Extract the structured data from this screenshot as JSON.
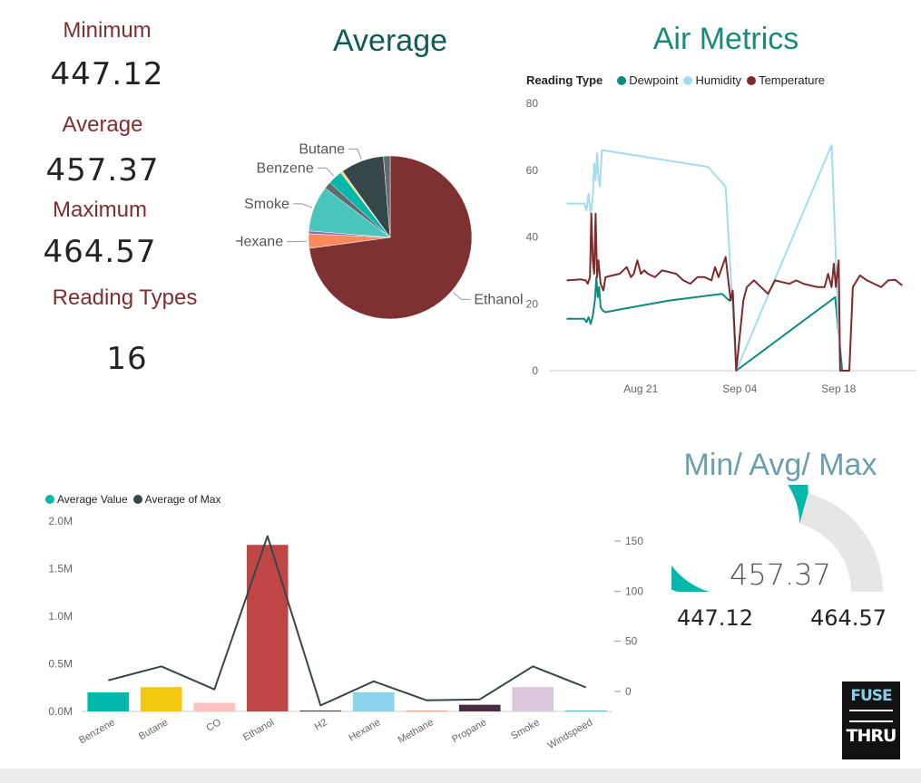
{
  "kpis": {
    "minimum_label": "Minimum",
    "minimum_value": "447.12",
    "average_label": "Average",
    "average_value": "457.37",
    "maximum_label": "Maximum",
    "maximum_value": "464.57",
    "reading_types_label": "Reading Types",
    "reading_types_value": "16"
  },
  "colors": {
    "kpi_label": "#7f2f2f",
    "title_teal": "#1a8a7a",
    "title_dark_teal": "#0e5c55",
    "gauge_fill": "#01b8aa",
    "gauge_track": "#e6e6e6",
    "gauge_title": "#6c9fae"
  },
  "chart_data": [
    {
      "type": "pie",
      "title": "Average",
      "slices": [
        {
          "label": "Ethanol",
          "value": 76.5,
          "color": "#7f3030"
        },
        {
          "label": "Hexane",
          "value": 3.0,
          "color": "#fd8a5e"
        },
        {
          "label": "",
          "value": 0.6,
          "color": "#8d6fb0"
        },
        {
          "label": "Smoke",
          "value": 9.5,
          "color": "#4ac5bb"
        },
        {
          "label": "",
          "value": 1.5,
          "color": "#5f6b6d"
        },
        {
          "label": "Benzene",
          "value": 3.0,
          "color": "#01b8aa"
        },
        {
          "label": "",
          "value": 0.3,
          "color": "#f2c80f"
        },
        {
          "label": "",
          "value": 0.2,
          "color": "#ffc0c0"
        },
        {
          "label": "Butane",
          "value": 9.0,
          "color": "#374649"
        },
        {
          "label": "",
          "value": 1.4,
          "color": "#5f6b6d"
        }
      ]
    },
    {
      "type": "line",
      "title": "Air Metrics",
      "legend_title": "Reading Type",
      "y_ticks": [
        0,
        20,
        40,
        60,
        80
      ],
      "ylim": [
        0,
        80
      ],
      "x_ticks": [
        "Aug 21",
        "Sep 04",
        "Sep 18"
      ],
      "x_tick_days": [
        21,
        35,
        49
      ],
      "xlim_days": [
        8,
        60
      ],
      "series": [
        {
          "name": "Dewpoint",
          "color": "#0e8a7e",
          "points": [
            [
              10.5,
              15.5
            ],
            [
              13,
              15.5
            ],
            [
              13.3,
              14.5
            ],
            [
              13.6,
              16
            ],
            [
              13.9,
              14
            ],
            [
              14.2,
              16.5
            ],
            [
              14.5,
              21
            ],
            [
              14.7,
              28
            ],
            [
              14.9,
              22
            ],
            [
              15.1,
              25
            ],
            [
              15.3,
              19
            ],
            [
              15.6,
              18
            ],
            [
              16,
              17.5
            ],
            [
              18,
              18.3
            ],
            [
              25,
              21
            ],
            [
              32.5,
              23
            ],
            [
              33.5,
              21
            ],
            [
              34,
              23
            ],
            [
              34.5,
              0
            ],
            [
              48.5,
              22
            ],
            [
              49.5,
              0
            ]
          ]
        },
        {
          "name": "Humidity",
          "color": "#a4dcef",
          "points": [
            [
              10.5,
              50
            ],
            [
              13,
              50
            ],
            [
              13.3,
              48
            ],
            [
              13.6,
              53
            ],
            [
              13.9,
              47
            ],
            [
              14.2,
              52
            ],
            [
              14.4,
              62
            ],
            [
              14.6,
              57
            ],
            [
              14.8,
              65
            ],
            [
              15.0,
              58
            ],
            [
              15.2,
              55
            ],
            [
              15.5,
              66
            ],
            [
              30.5,
              61
            ],
            [
              33,
              55
            ],
            [
              34.5,
              0
            ],
            [
              48,
              67.5
            ],
            [
              49.2,
              0
            ]
          ]
        },
        {
          "name": "Temperature",
          "color": "#7f2a2a",
          "points": [
            [
              10.5,
              27
            ],
            [
              12.5,
              27.3
            ],
            [
              13.2,
              27
            ],
            [
              13.5,
              26
            ],
            [
              13.8,
              28
            ],
            [
              14.0,
              47
            ],
            [
              14.2,
              33
            ],
            [
              14.4,
              29
            ],
            [
              14.6,
              47
            ],
            [
              14.8,
              28
            ],
            [
              15,
              33
            ],
            [
              15.3,
              26
            ],
            [
              15.7,
              24
            ],
            [
              16,
              28
            ],
            [
              17,
              28.5
            ],
            [
              18,
              29
            ],
            [
              19,
              31
            ],
            [
              19.6,
              28
            ],
            [
              20,
              29
            ],
            [
              20.5,
              33
            ],
            [
              21,
              29
            ],
            [
              21.5,
              30
            ],
            [
              22,
              29
            ],
            [
              23,
              28
            ],
            [
              24,
              30
            ],
            [
              25,
              29.5
            ],
            [
              26,
              29
            ],
            [
              27,
              27
            ],
            [
              28,
              26
            ],
            [
              29,
              28
            ],
            [
              30,
              28
            ],
            [
              31,
              27
            ],
            [
              31.5,
              31
            ],
            [
              32,
              28
            ],
            [
              33,
              34
            ],
            [
              33.7,
              21
            ],
            [
              34.0,
              24
            ],
            [
              34.5,
              0
            ],
            [
              35.5,
              21
            ],
            [
              36,
              25
            ],
            [
              37,
              27
            ],
            [
              38,
              25
            ],
            [
              39,
              23
            ],
            [
              40,
              27
            ],
            [
              41,
              26.5
            ],
            [
              42,
              26
            ],
            [
              43,
              27
            ],
            [
              44,
              26
            ],
            [
              45,
              25.5
            ],
            [
              46,
              25
            ],
            [
              47,
              25
            ],
            [
              47.5,
              29
            ],
            [
              48,
              25
            ],
            [
              48.3,
              32
            ],
            [
              48.6,
              25
            ],
            [
              49,
              33
            ],
            [
              49.2,
              0
            ],
            [
              50.5,
              0
            ],
            [
              51,
              25
            ],
            [
              52,
              28.5
            ],
            [
              53,
              27
            ],
            [
              54,
              26
            ],
            [
              55,
              25
            ],
            [
              56,
              27
            ],
            [
              57,
              27.2
            ],
            [
              58,
              25.5
            ]
          ]
        }
      ]
    },
    {
      "type": "bar",
      "title": "",
      "legend": [
        "Average Value",
        "Average of Max"
      ],
      "categories": [
        "Benzene",
        "Butane",
        "CO",
        "Ethanol",
        "H2",
        "Hexane",
        "Methane",
        "Propane",
        "Smoke",
        "Windspeed"
      ],
      "bar_colors": [
        "#01b8aa",
        "#f2c80f",
        "#ffc0c0",
        "#c04545",
        "#374649",
        "#8ad4eb",
        "#fd9e89",
        "#4a2a40",
        "#d9c6d9",
        "#4ac5bb"
      ],
      "series": [
        {
          "name": "Average Value",
          "values": [
            200000,
            255000,
            90000,
            1750000,
            8000,
            200000,
            6000,
            70000,
            255000,
            10000
          ]
        },
        {
          "name": "Average of Max",
          "values": [
            11,
            25,
            2,
            155,
            -14,
            10,
            -9,
            -8,
            25,
            4
          ]
        }
      ],
      "y_left_ticks": [
        "0.0M",
        "0.5M",
        "1.0M",
        "1.5M",
        "2.0M"
      ],
      "y_left_values": [
        0,
        500000,
        1000000,
        1500000,
        2000000
      ],
      "y_right_ticks": [
        "0",
        "50",
        "100",
        "150"
      ],
      "y_right_values": [
        0,
        50,
        100,
        150
      ],
      "ylim_left": [
        0,
        2000000
      ],
      "ylim_right": [
        -20,
        170
      ]
    }
  ],
  "gauge": {
    "title": "Min/ Avg/ Max",
    "value": 457.37,
    "min": 447.12,
    "max": 464.57,
    "value_label": "457.37",
    "min_label": "447.12",
    "max_label": "464.57"
  },
  "logo": {
    "line1": "FUSE",
    "line2": "THRU"
  }
}
